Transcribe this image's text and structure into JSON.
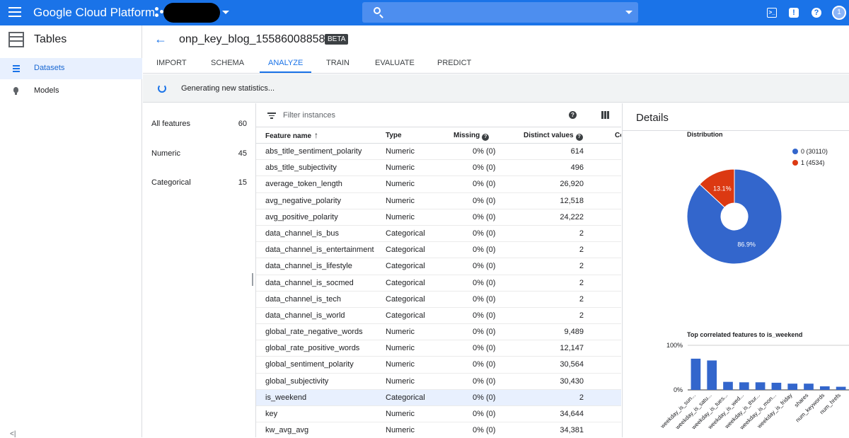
{
  "topbar": {
    "brand": "Google Cloud Platform",
    "search_placeholder": "",
    "cloudshell_glyph": ">_",
    "notif_glyph": "!",
    "help_glyph": "?",
    "avatar_initial": "1"
  },
  "sidebar": {
    "title": "Tables",
    "items": [
      {
        "label": "Datasets",
        "icon": "list-icon",
        "active": true
      },
      {
        "label": "Models",
        "icon": "lightbulb-icon",
        "active": false
      }
    ],
    "collapse_glyph": "<|"
  },
  "header": {
    "back_glyph": "←",
    "dataset_name": "onp_key_blog_1558600885878",
    "badge": "BETA"
  },
  "tabs": [
    "IMPORT",
    "SCHEMA",
    "ANALYZE",
    "TRAIN",
    "EVALUATE",
    "PREDICT"
  ],
  "active_tab": "ANALYZE",
  "status": {
    "text": "Generating new statistics..."
  },
  "feature_groups": [
    {
      "label": "All features",
      "count": "60"
    },
    {
      "label": "Numeric",
      "count": "45"
    },
    {
      "label": "Categorical",
      "count": "15"
    }
  ],
  "table": {
    "filter_placeholder": "Filter instances",
    "help_glyph": "?",
    "headers": {
      "name": "Feature name",
      "sort_glyph": "↑",
      "type": "Type",
      "missing": "Missing",
      "distinct": "Distinct values",
      "corr": "Co"
    },
    "rows": [
      {
        "name": "abs_title_sentiment_polarity",
        "type": "Numeric",
        "missing": "0% (0)",
        "distinct": "614"
      },
      {
        "name": "abs_title_subjectivity",
        "type": "Numeric",
        "missing": "0% (0)",
        "distinct": "496"
      },
      {
        "name": "average_token_length",
        "type": "Numeric",
        "missing": "0% (0)",
        "distinct": "26,920"
      },
      {
        "name": "avg_negative_polarity",
        "type": "Numeric",
        "missing": "0% (0)",
        "distinct": "12,518"
      },
      {
        "name": "avg_positive_polarity",
        "type": "Numeric",
        "missing": "0% (0)",
        "distinct": "24,222"
      },
      {
        "name": "data_channel_is_bus",
        "type": "Categorical",
        "missing": "0% (0)",
        "distinct": "2"
      },
      {
        "name": "data_channel_is_entertainment",
        "type": "Categorical",
        "missing": "0% (0)",
        "distinct": "2"
      },
      {
        "name": "data_channel_is_lifestyle",
        "type": "Categorical",
        "missing": "0% (0)",
        "distinct": "2"
      },
      {
        "name": "data_channel_is_socmed",
        "type": "Categorical",
        "missing": "0% (0)",
        "distinct": "2"
      },
      {
        "name": "data_channel_is_tech",
        "type": "Categorical",
        "missing": "0% (0)",
        "distinct": "2"
      },
      {
        "name": "data_channel_is_world",
        "type": "Categorical",
        "missing": "0% (0)",
        "distinct": "2"
      },
      {
        "name": "global_rate_negative_words",
        "type": "Numeric",
        "missing": "0% (0)",
        "distinct": "9,489"
      },
      {
        "name": "global_rate_positive_words",
        "type": "Numeric",
        "missing": "0% (0)",
        "distinct": "12,147"
      },
      {
        "name": "global_sentiment_polarity",
        "type": "Numeric",
        "missing": "0% (0)",
        "distinct": "30,564"
      },
      {
        "name": "global_subjectivity",
        "type": "Numeric",
        "missing": "0% (0)",
        "distinct": "30,430"
      },
      {
        "name": "is_weekend",
        "type": "Categorical",
        "missing": "0% (0)",
        "distinct": "2",
        "selected": true
      },
      {
        "name": "key",
        "type": "Numeric",
        "missing": "0% (0)",
        "distinct": "34,644"
      },
      {
        "name": "kw_avg_avg",
        "type": "Numeric",
        "missing": "0% (0)",
        "distinct": "34,381"
      }
    ]
  },
  "details": {
    "title": "Details"
  },
  "colors": {
    "accent": "#1a73e8",
    "pie_blue": "#3366cc",
    "pie_red": "#dc3912"
  },
  "chart_data": [
    {
      "type": "pie",
      "title": "Distribution",
      "donut": true,
      "categories": [
        "0 (30110)",
        "1 (4534)"
      ],
      "values": [
        30110,
        4534
      ],
      "slice_labels": [
        "86.9%",
        "13.1%"
      ],
      "colors": [
        "#3366cc",
        "#dc3912"
      ],
      "legend": "right"
    },
    {
      "type": "bar",
      "title": "Top correlated features to is_weekend",
      "categories": [
        "weekday_is_sun...",
        "weekday_is_satu...",
        "weekday_is_tues...",
        "weekday_is_wed...",
        "weekday_is_thur...",
        "weekday_is_mon...",
        "weekday_is_friday",
        "shares",
        "num_keywords",
        "num_hrefs"
      ],
      "values": [
        70,
        66,
        18,
        17,
        17,
        16,
        14,
        14,
        8,
        7
      ],
      "yticks": [
        "100%",
        "0%"
      ],
      "ylim": [
        0,
        100
      ],
      "color": "#3366cc"
    }
  ]
}
